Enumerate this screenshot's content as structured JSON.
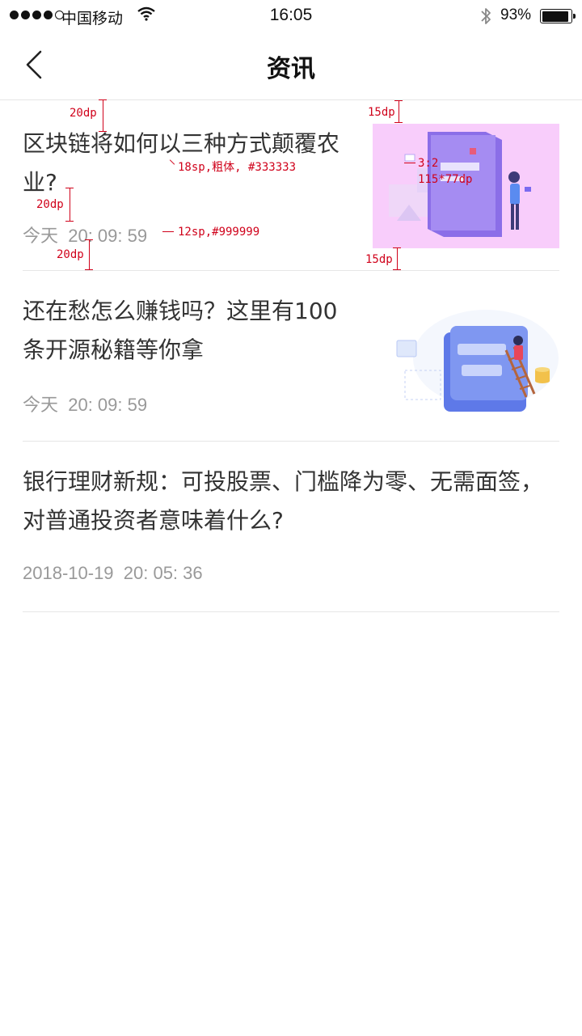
{
  "status_bar": {
    "carrier": "中国移动",
    "time": "16:05",
    "battery": "93%",
    "battery_level": 0.93
  },
  "nav": {
    "title": "资讯"
  },
  "news": [
    {
      "title": "区块链将如何以三种方式颠覆农业?",
      "time": "今天  20: 09: 59"
    },
    {
      "title": "还在愁怎么赚钱吗？这里有100条开源秘籍等你拿",
      "time": "今天  20: 09: 59"
    },
    {
      "title": "银行理财新规：可投股票、门槛降为零、无需面签，对普通投资者意味着什么?",
      "time": "2018-10-19  20: 05: 36"
    }
  ],
  "annotations": {
    "title_top_gap": "20dp",
    "title_time_gap": "20dp",
    "time_bottom_gap": "20dp",
    "image_top_gap": "15dp",
    "image_bottom_gap": "15dp",
    "title_spec": "18sp,粗体, #333333",
    "time_spec": "12sp,#999999",
    "image_ratio": "3:2",
    "image_size": "115*77dp"
  },
  "colors": {
    "title": "#333333",
    "time": "#999999",
    "annotation": "#d0021b",
    "thumb1_bg": "#f8cdfb"
  }
}
